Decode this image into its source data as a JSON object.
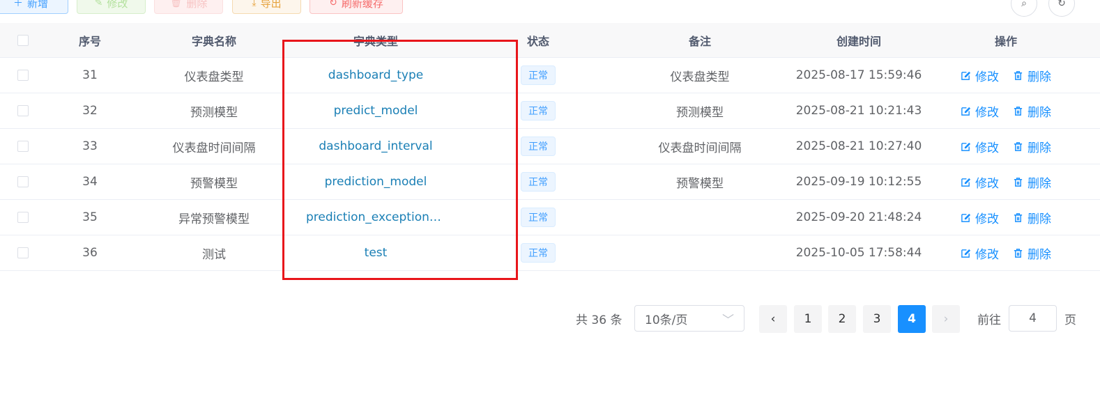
{
  "toolbar": {
    "add_label": "新增",
    "edit_label": "修改",
    "delete_label": "删除",
    "export_label": "导出",
    "refresh_cache_label": "刷新缓存"
  },
  "table": {
    "headers": {
      "index": "序号",
      "name": "字典名称",
      "type": "字典类型",
      "status": "状态",
      "remark": "备注",
      "created": "创建时间",
      "actions": "操作"
    },
    "rows": [
      {
        "index": "31",
        "name": "仪表盘类型",
        "type": "dashboard_type",
        "status": "正常",
        "remark": "仪表盘类型",
        "created": "2025-08-17 15:59:46"
      },
      {
        "index": "32",
        "name": "预测模型",
        "type": "predict_model",
        "status": "正常",
        "remark": "预测模型",
        "created": "2025-08-21 10:21:43"
      },
      {
        "index": "33",
        "name": "仪表盘时间间隔",
        "type": "dashboard_interval",
        "status": "正常",
        "remark": "仪表盘时间间隔",
        "created": "2025-08-21 10:27:40"
      },
      {
        "index": "34",
        "name": "预警模型",
        "type": "prediction_model",
        "status": "正常",
        "remark": "预警模型",
        "created": "2025-09-19 10:12:55"
      },
      {
        "index": "35",
        "name": "异常预警模型",
        "type": "prediction_exception_…",
        "status": "正常",
        "remark": "",
        "created": "2025-09-20 21:48:24"
      },
      {
        "index": "36",
        "name": "测试",
        "type": "test",
        "status": "正常",
        "remark": "",
        "created": "2025-10-05 17:58:44"
      }
    ],
    "row_edit_label": "修改",
    "row_delete_label": "删除"
  },
  "pagination": {
    "total_text": "共 36 条",
    "page_size": "10条/页",
    "pages": [
      "1",
      "2",
      "3",
      "4"
    ],
    "current_page": "4",
    "goto_prefix": "前往",
    "goto_value": "4",
    "goto_suffix": "页"
  },
  "colors": {
    "primary": "#1890ff",
    "highlight_box": "#e8161b",
    "tag_bg": "#ecf5ff"
  }
}
